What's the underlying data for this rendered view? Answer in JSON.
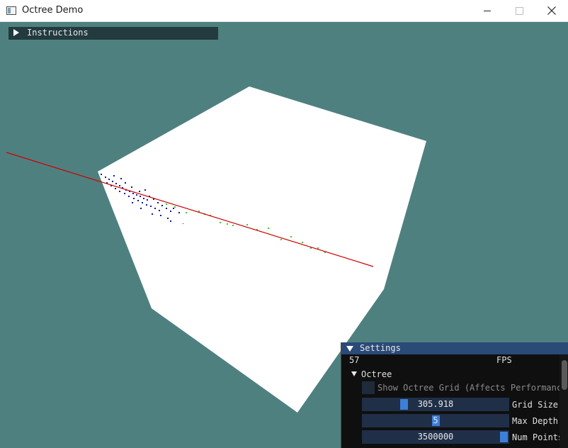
{
  "window": {
    "title": "Octree Demo",
    "icons": {
      "app": "app-window-icon",
      "minimize": "minimize-icon",
      "maximize": "maximize-icon",
      "close": "close-icon"
    }
  },
  "viewport": {
    "background": "#4f8080",
    "line_color": "#cc0000",
    "cube_color": "#ffffff"
  },
  "instructions": {
    "label": "Instructions",
    "collapsed": true
  },
  "settings": {
    "title": "Settings",
    "fps_value": "57",
    "fps_label": "FPS",
    "octree_label": "Octree",
    "show_grid_label": "Show Octree Grid (Affects Performance",
    "show_grid_checked": false,
    "grid_size": {
      "value": "305.918",
      "label": "Grid Size"
    },
    "max_depth": {
      "value": "5",
      "label": "Max Depth"
    },
    "num_points": {
      "value": "3500000",
      "label": "Num Points"
    }
  }
}
